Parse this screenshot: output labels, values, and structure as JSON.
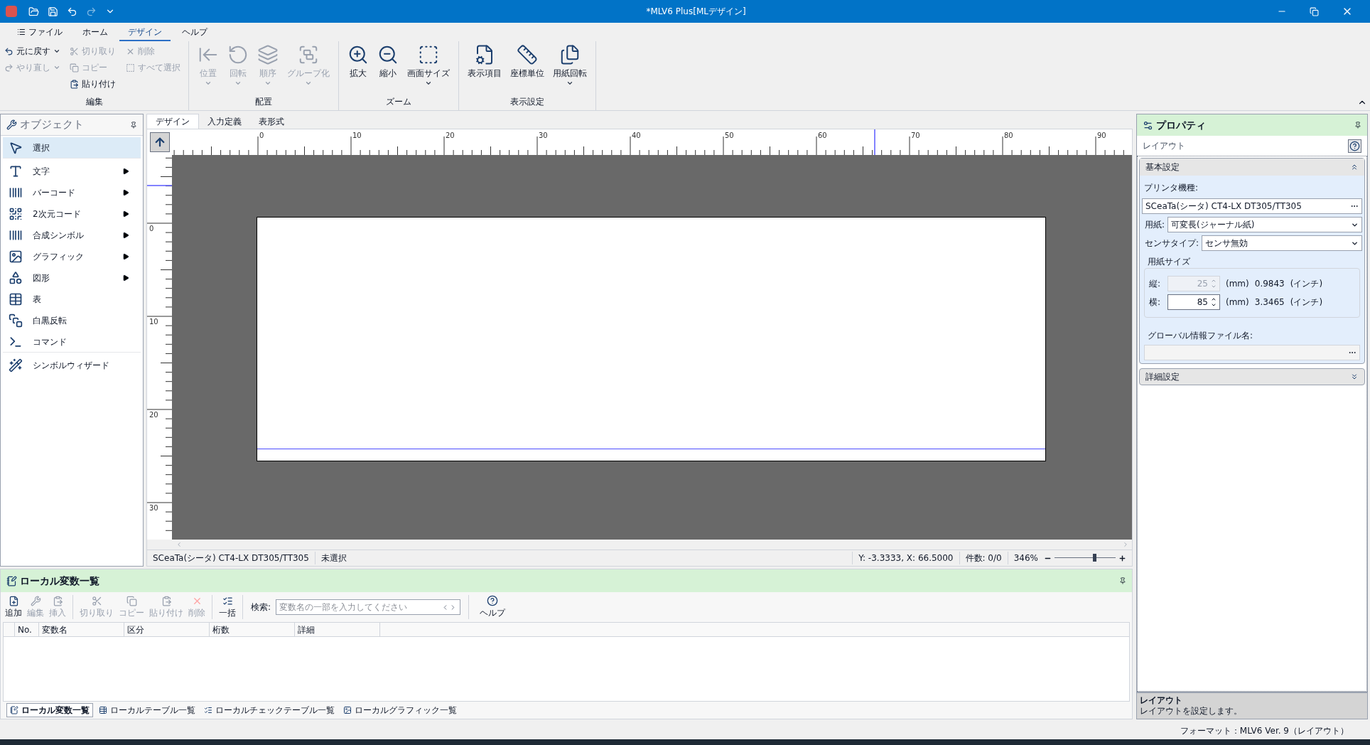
{
  "window": {
    "title": "*MLV6 Plus[MLデザイン]"
  },
  "ribbon_tabs": [
    {
      "label": "ファイル",
      "selected": false
    },
    {
      "label": "ホーム",
      "selected": false
    },
    {
      "label": "デザイン",
      "selected": true
    },
    {
      "label": "ヘルプ",
      "selected": false
    }
  ],
  "edit_group": {
    "label": "編集",
    "buttons": [
      {
        "label": "元に戻す",
        "disabled": false,
        "dropdown": true
      },
      {
        "label": "切り取り",
        "disabled": true,
        "dropdown": false
      },
      {
        "label": "削除",
        "disabled": true,
        "dropdown": false
      },
      {
        "label": "やり直し",
        "disabled": true,
        "dropdown": true
      },
      {
        "label": "コピー",
        "disabled": true,
        "dropdown": false
      },
      {
        "label": "すべて選択",
        "disabled": true,
        "dropdown": false
      },
      {
        "label": "貼り付け",
        "disabled": false,
        "dropdown": false
      }
    ]
  },
  "ribbon_groups": [
    {
      "label": "配置",
      "buttons": [
        {
          "label": "位置",
          "disabled": true,
          "dropdown": true
        },
        {
          "label": "回転",
          "disabled": true,
          "dropdown": true
        },
        {
          "label": "順序",
          "disabled": true,
          "dropdown": true
        },
        {
          "label": "グループ化",
          "disabled": true,
          "dropdown": true
        }
      ]
    },
    {
      "label": "ズーム",
      "buttons": [
        {
          "label": "拡大",
          "disabled": false,
          "dropdown": false
        },
        {
          "label": "縮小",
          "disabled": false,
          "dropdown": false
        },
        {
          "label": "画面サイズ",
          "disabled": false,
          "dropdown": true
        }
      ]
    },
    {
      "label": "表示設定",
      "buttons": [
        {
          "label": "表示項目",
          "disabled": false,
          "dropdown": false
        },
        {
          "label": "座標単位",
          "disabled": false,
          "dropdown": false
        },
        {
          "label": "用紙回転",
          "disabled": false,
          "dropdown": true
        }
      ]
    }
  ],
  "objects_panel": {
    "title": "オブジェクト",
    "items": [
      {
        "label": "選択",
        "selected": true,
        "submenu": false
      },
      {
        "label": "文字",
        "selected": false,
        "submenu": true
      },
      {
        "label": "バーコード",
        "selected": false,
        "submenu": true
      },
      {
        "label": "2次元コード",
        "selected": false,
        "submenu": true
      },
      {
        "label": "合成シンボル",
        "selected": false,
        "submenu": true
      },
      {
        "label": "グラフィック",
        "selected": false,
        "submenu": true
      },
      {
        "label": "図形",
        "selected": false,
        "submenu": true
      },
      {
        "label": "表",
        "selected": false,
        "submenu": false
      },
      {
        "label": "白黒反転",
        "selected": false,
        "submenu": false
      },
      {
        "label": "コマンド",
        "selected": false,
        "submenu": false
      },
      {
        "label": "シンボルウィザード",
        "selected": false,
        "submenu": false
      }
    ]
  },
  "canvas_tabs": [
    {
      "label": "デザイン",
      "selected": true
    },
    {
      "label": "入力定義",
      "selected": false
    },
    {
      "label": "表形式",
      "selected": false
    }
  ],
  "ruler": {
    "horizontal_labels": [
      "0",
      "10",
      "20",
      "30",
      "40",
      "50",
      "60",
      "70",
      "80",
      "90"
    ],
    "vertical_labels": [
      "0",
      "10",
      "20",
      "30"
    ]
  },
  "canvas_status": {
    "printer": "SCeaTa(シータ) CT4-LX DT305/TT305",
    "selection": "未選択",
    "coordinates": "Y: -3.3333, X: 66.5000",
    "count": "件数: 0/0",
    "zoom": "346%",
    "zoom_slider": {
      "level": 0.65
    }
  },
  "properties": {
    "title": "プロパティ",
    "subtitle": "レイアウト",
    "basic": {
      "title": "基本設定",
      "expanded": true,
      "printer_label": "プリンタ機種:",
      "printer_value": "SCeaTa(シータ) CT4-LX DT305/TT305",
      "paper_label": "用紙:",
      "paper_value": "可変長(ジャーナル紙)",
      "sensor_label": "センサタイプ:",
      "sensor_value": "センサ無効",
      "size_group": "用紙サイズ",
      "sizes": [
        {
          "label": "縦:",
          "value": "25",
          "disabled": true,
          "unit": "(mm)",
          "inch": "0.9843",
          "inch_unit": "(インチ)"
        },
        {
          "label": "横:",
          "value": "85",
          "disabled": false,
          "unit": "(mm)",
          "inch": "3.3465",
          "inch_unit": "(インチ)"
        }
      ],
      "global_label": "グローバル情報ファイル名:"
    },
    "detail": {
      "title": "詳細設定",
      "expanded": false
    },
    "description": {
      "title": "レイアウト",
      "text": "レイアウトを設定します。"
    }
  },
  "variables_panel": {
    "title": "ローカル変数一覧",
    "toolbar": [
      {
        "label": "追加",
        "disabled": false
      },
      {
        "label": "編集",
        "disabled": true
      },
      {
        "label": "挿入",
        "disabled": true
      },
      {
        "label": "切り取り",
        "disabled": true
      },
      {
        "label": "コピー",
        "disabled": true
      },
      {
        "label": "貼り付け",
        "disabled": true
      },
      {
        "label": "削除",
        "disabled": true
      },
      {
        "label": "一括",
        "disabled": false
      }
    ],
    "search_label": "検索:",
    "search_placeholder": "変数名の一部を入力してください",
    "help": "ヘルプ",
    "columns": [
      "No.",
      "変数名",
      "区分",
      "桁数",
      "詳細"
    ],
    "tabs": [
      {
        "label": "ローカル変数一覧",
        "selected": true
      },
      {
        "label": "ローカルテーブル一覧",
        "selected": false
      },
      {
        "label": "ローカルチェックテーブル一覧",
        "selected": false
      },
      {
        "label": "ローカルグラフィック一覧",
        "selected": false
      }
    ]
  },
  "status_bar": {
    "format": "フォーマット：MLV6 Ver. 9（レイアウト）"
  }
}
